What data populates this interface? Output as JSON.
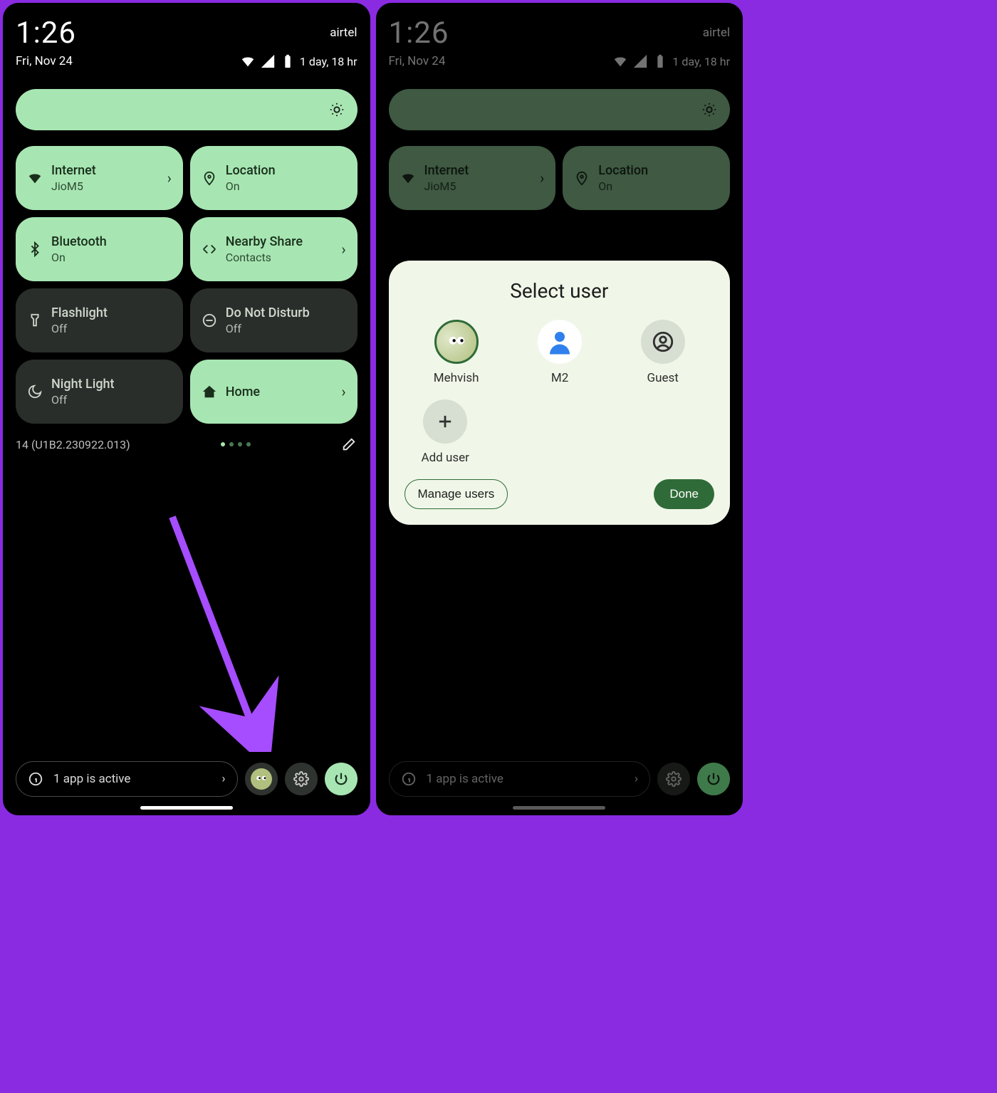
{
  "status": {
    "time": "1:26",
    "carrier": "airtel",
    "date": "Fri, Nov 24",
    "battery_text": "1 day, 18 hr"
  },
  "tiles": {
    "internet": {
      "title": "Internet",
      "sub": "JioM5",
      "state": "on"
    },
    "location": {
      "title": "Location",
      "sub": "On",
      "state": "on"
    },
    "bluetooth": {
      "title": "Bluetooth",
      "sub": "On",
      "state": "on"
    },
    "nearby": {
      "title": "Nearby Share",
      "sub": "Contacts",
      "state": "on"
    },
    "flashlight": {
      "title": "Flashlight",
      "sub": "Off",
      "state": "off"
    },
    "dnd": {
      "title": "Do Not Disturb",
      "sub": "Off",
      "state": "off"
    },
    "nightlight": {
      "title": "Night Light",
      "sub": "Off",
      "state": "off"
    },
    "home": {
      "title": "Home",
      "sub": "",
      "state": "on"
    }
  },
  "build": "14 (U1B2.230922.013)",
  "footer": {
    "active_apps": "1 app is active"
  },
  "dialog": {
    "title": "Select user",
    "users": {
      "u1": "Mehvish",
      "u2": "M2",
      "u3": "Guest"
    },
    "add_user": "Add user",
    "manage": "Manage users",
    "done": "Done"
  },
  "colors": {
    "accent": "#a7e6b2",
    "accent_dark": "#2f6b38"
  }
}
